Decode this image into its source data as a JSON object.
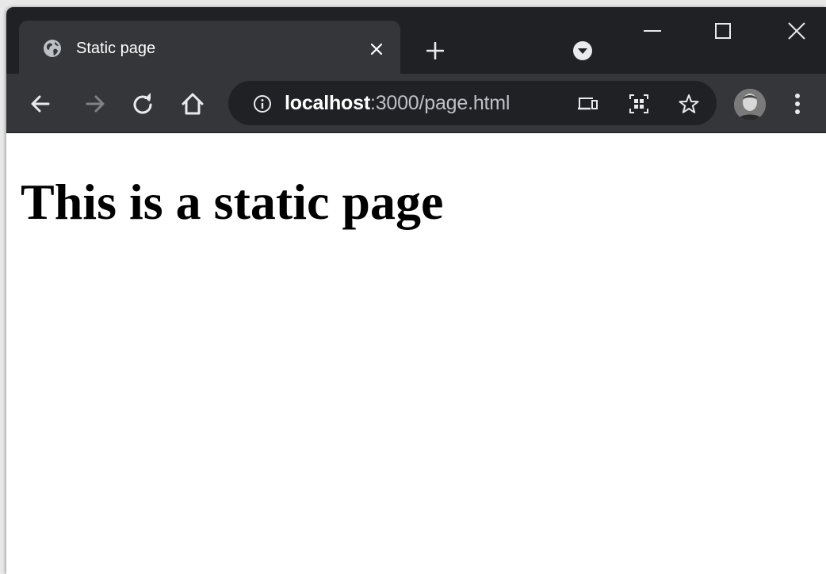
{
  "colors": {
    "titlebar_bg": "#202124",
    "toolbar_bg": "#35363a",
    "omnibox_bg": "#202124",
    "icon_color": "#e8eaed",
    "icon_disabled": "#7f8184"
  },
  "tab": {
    "title": "Static page",
    "favicon": "globe-icon",
    "close_icon": "close-icon"
  },
  "titlebar": {
    "new_tab_icon": "plus-icon",
    "tab_search_icon": "chevron-down-circle-icon",
    "window_controls": [
      "minimize-icon",
      "maximize-icon",
      "close-icon"
    ]
  },
  "toolbar": {
    "back_icon": "arrow-left-icon",
    "forward_icon": "arrow-right-icon",
    "reload_icon": "reload-icon",
    "home_icon": "home-icon",
    "site_info_icon": "info-icon",
    "cast_icon": "cast-devices-icon",
    "qr_icon": "qr-code-icon",
    "bookmark_icon": "star-icon",
    "menu_icon": "more-vertical-icon"
  },
  "address": {
    "host": "localhost",
    "path": ":3000/page.html"
  },
  "page": {
    "heading": "This is a static page"
  }
}
